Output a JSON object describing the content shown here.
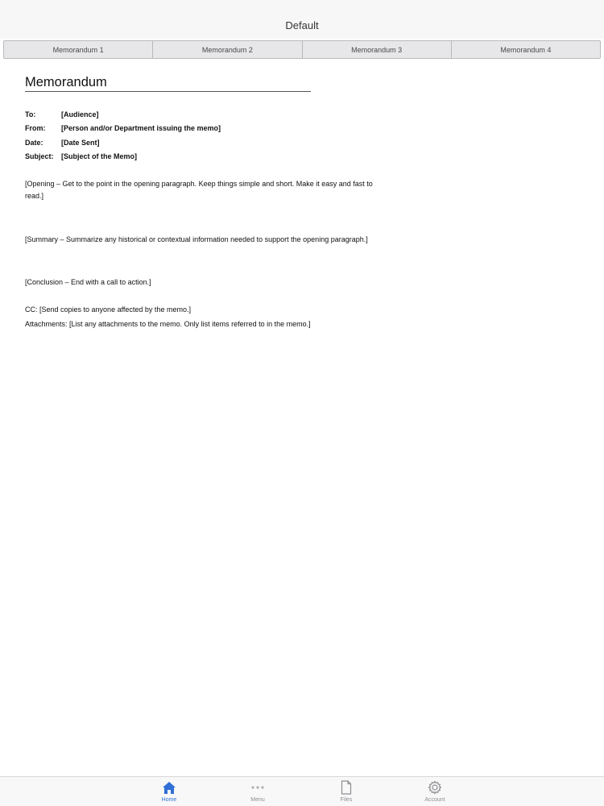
{
  "nav": {
    "title": "Default"
  },
  "segments": [
    "Memorandum 1",
    "Memorandum 2",
    "Memorandum 3",
    "Memorandum 4"
  ],
  "document": {
    "title": "Memorandum",
    "fields": [
      {
        "label": "To:",
        "value": "[Audience]"
      },
      {
        "label": "From:",
        "value": "[Person and/or Department issuing the memo]"
      },
      {
        "label": "Date:",
        "value": "[Date Sent]"
      },
      {
        "label": "Subject:",
        "value": "[Subject of the Memo]"
      }
    ],
    "opening": "[Opening – Get to the point in the opening paragraph. Keep things simple and short. Make it easy and fast to read.]",
    "summary": "[Summary – Summarize any historical or contextual information needed to support the opening paragraph.]",
    "conclusion": "[Conclusion – End with a call to action.]",
    "cc": "CC: [Send copies to anyone affected by the memo.]",
    "attachments": "Attachments: [List any attachments to the memo. Only list items referred to in the memo.]"
  },
  "tabbar": {
    "active": "Home",
    "items": [
      {
        "label": "Home",
        "icon": "home-icon"
      },
      {
        "label": "Menu",
        "icon": "more-icon"
      },
      {
        "label": "Files",
        "icon": "file-icon"
      },
      {
        "label": "Account",
        "icon": "gear-icon"
      }
    ]
  },
  "colors": {
    "accent": "#2f6fd6",
    "inactive": "#8e8e93"
  }
}
